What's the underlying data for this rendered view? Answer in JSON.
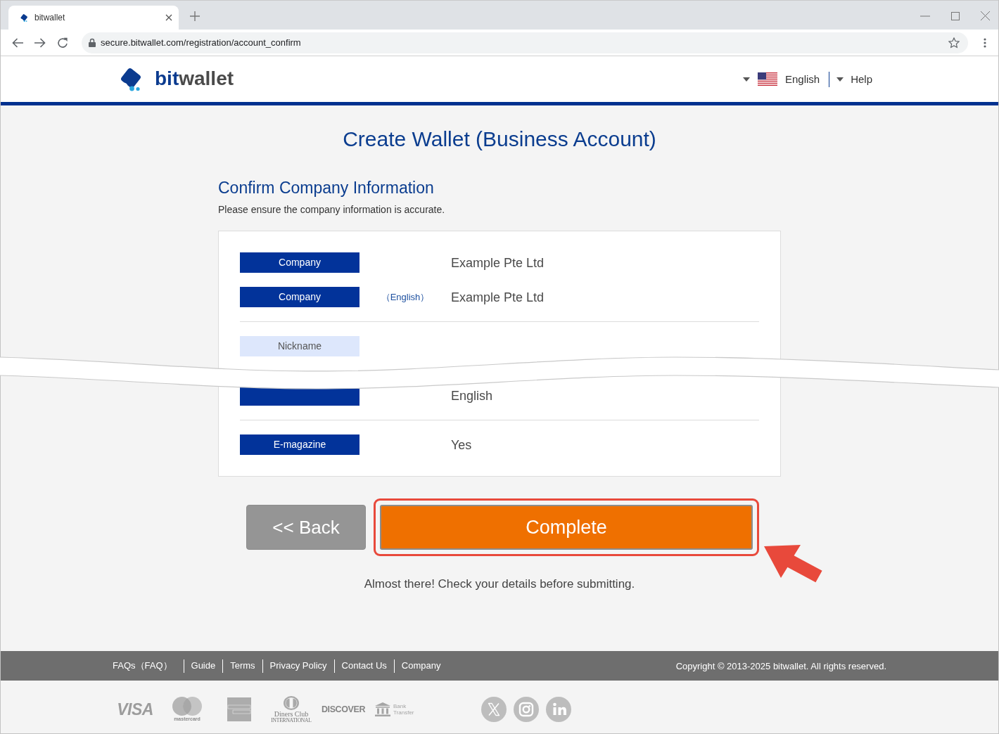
{
  "browser": {
    "tab_title": "bitwallet",
    "url": "secure.bitwallet.com/registration/account_confirm"
  },
  "header": {
    "logo": [
      "bit",
      "wallet"
    ],
    "language": "English",
    "help": "Help"
  },
  "page": {
    "title": "Create Wallet (Business Account)",
    "section_title": "Confirm Company Information",
    "intro": "Please ensure the company information is accurate."
  },
  "card": {
    "wave_break": true,
    "sections": [
      {
        "rows": [
          {
            "label": "Company",
            "required": true,
            "value": "Example Pte Ltd"
          },
          {
            "label": "Company",
            "required": true,
            "sublabel": "（English）",
            "value": "Example Pte Ltd"
          }
        ]
      },
      {
        "rows": [
          {
            "label": "Nickname",
            "required": false
          }
        ]
      },
      {
        "rows": [
          {
            "required": true,
            "value": "English"
          }
        ]
      },
      {
        "rows": [
          {
            "label": "E-magazine",
            "required": true,
            "value": "Yes"
          }
        ]
      }
    ]
  },
  "actions": {
    "back": "<< Back",
    "complete": {
      "label": "Complete",
      "highlighted": true
    },
    "note": "Almost there! Check your details before submitting."
  },
  "footer": {
    "links": [
      "FAQs（FAQ）",
      "Guide",
      "Terms",
      "Privacy Policy",
      "Contact Us",
      "Company"
    ],
    "copyright": "Copyright © 2013-2025 bitwallet. All rights reserved.",
    "payment_logos": [
      {
        "kind": "visa",
        "text": "VISA"
      },
      {
        "kind": "mastercard",
        "text": "mastercard"
      },
      {
        "kind": "amex"
      },
      {
        "kind": "diners",
        "text": "Diners Club",
        "subtext": "INTERNATIONAL"
      },
      {
        "kind": "discover",
        "text": "DISCOVER"
      },
      {
        "kind": "bank",
        "text": "Bank Transfer"
      }
    ],
    "social": [
      {
        "kind": "x"
      },
      {
        "kind": "instagram"
      },
      {
        "kind": "linkedin"
      }
    ]
  }
}
